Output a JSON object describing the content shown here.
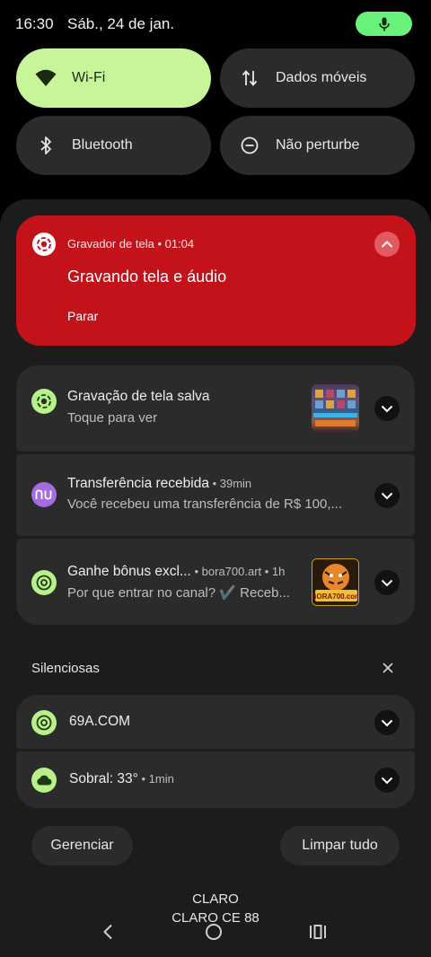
{
  "status_bar": {
    "time": "16:30",
    "date": "Sáb., 24 de jan.",
    "mic_indicator_color": "#69f27a"
  },
  "quick_settings": {
    "tiles": [
      {
        "label": "Wi-Fi",
        "icon": "wifi-icon",
        "active": true
      },
      {
        "label": "Dados móveis",
        "icon": "mobile-data-icon",
        "active": false
      },
      {
        "label": "Bluetooth",
        "icon": "bluetooth-icon",
        "active": false
      },
      {
        "label": "Não perturbe",
        "icon": "do-not-disturb-icon",
        "active": false
      }
    ]
  },
  "recording": {
    "app_name": "Gravador de tela",
    "elapsed": "01:04",
    "header": "Gravador de tela • 01:04",
    "title": "Gravando tela e áudio",
    "action": "Parar",
    "accent": "#c4121b"
  },
  "notifications": [
    {
      "title": "Gravação de tela salva",
      "meta": "",
      "text": "Toque para ver",
      "icon": "screen-record-icon",
      "has_thumbnail": true
    },
    {
      "title": "Transferência recebida",
      "meta": " • 39min",
      "text": "Você recebeu uma transferência de R$ 100,...",
      "icon": "nubank-icon",
      "has_thumbnail": false
    },
    {
      "title": "Ganhe bônus excl...",
      "meta": " • bora700.art • 1h",
      "text": "Por que entrar no canal? ✔️ Receb...",
      "icon": "chrome-icon",
      "has_thumbnail": true,
      "thumbnail_text": "BORA700.com"
    }
  ],
  "silent_section": {
    "label": "Silenciosas",
    "items": [
      {
        "title": "69A.COM",
        "meta": "",
        "icon": "chrome-icon"
      },
      {
        "title": "Sobral: 33°",
        "meta": " • 1min",
        "icon": "cloud-icon"
      }
    ]
  },
  "footer": {
    "manage": "Gerenciar",
    "clear_all": "Limpar tudo"
  },
  "carrier": {
    "line1": "CLARO",
    "line2": "CLARO CE 88"
  }
}
